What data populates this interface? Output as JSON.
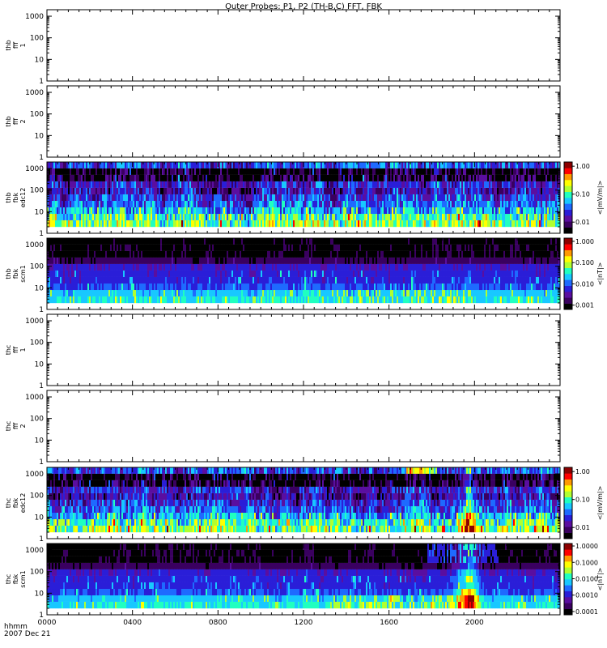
{
  "chart_data": {
    "type": "heatmap",
    "title": "Outer Probes: P1, P2 (TH-B,C) FFT, FBK",
    "x_axis": {
      "title_lines": [
        "hhmm",
        "2007 Dec 21"
      ],
      "range": [
        0,
        1440
      ],
      "tick_labels": [
        "0000",
        "0400",
        "0800",
        "1200",
        "1600",
        "2000"
      ],
      "tick_minutes": [
        0,
        240,
        480,
        720,
        960,
        1200
      ],
      "minor_step_minutes": 30
    },
    "y_axis": {
      "scale": "log",
      "range": [
        1,
        2000
      ],
      "tick_labels": [
        "1",
        "10",
        "100",
        "1000"
      ],
      "tick_values": [
        1,
        10,
        100,
        1000
      ],
      "spectrogram_floor": 2
    },
    "panels": [
      {
        "ylabel_lines": [
          "thb",
          "fff",
          "1"
        ],
        "kind": "empty"
      },
      {
        "ylabel_lines": [
          "thb",
          "fff",
          "2"
        ],
        "kind": "empty"
      },
      {
        "ylabel_lines": [
          "thb",
          "fbk",
          "edc12"
        ],
        "kind": "edc",
        "seed": 11,
        "colorbar": {
          "label": "<|mV/m|>",
          "tick_labels": [
            "1.00",
            "0.10",
            "0.01"
          ],
          "log_range": [
            -2.4,
            0.15
          ]
        }
      },
      {
        "ylabel_lines": [
          "thb",
          "fbk",
          "scm1"
        ],
        "kind": "scm",
        "seed": 23,
        "colorbar": {
          "label": "<|nT|>",
          "tick_labels": [
            "1.000",
            "0.100",
            "0.010",
            "0.001"
          ],
          "log_range": [
            -3.2,
            0.15
          ]
        }
      },
      {
        "ylabel_lines": [
          "thc",
          "fff",
          "1"
        ],
        "kind": "empty"
      },
      {
        "ylabel_lines": [
          "thc",
          "fff",
          "2"
        ],
        "kind": "empty"
      },
      {
        "ylabel_lines": [
          "thc",
          "fbk",
          "edc12"
        ],
        "kind": "edc",
        "seed": 37,
        "event": true,
        "colorbar": {
          "label": "<|mV/m|>",
          "tick_labels": [
            "1.00",
            "0.10",
            "0.01"
          ],
          "log_range": [
            -2.4,
            0.15
          ]
        }
      },
      {
        "ylabel_lines": [
          "thc",
          "fbk",
          "scm1"
        ],
        "kind": "scm",
        "seed": 53,
        "event": true,
        "colorbar": {
          "label": "<|nT|>",
          "tick_labels": [
            "1.0000",
            "0.1000",
            "0.0100",
            "0.0010",
            "0.0001"
          ],
          "log_range": [
            -4.2,
            0.15
          ]
        }
      }
    ],
    "frequency_bands": [
      2.9,
      5.7,
      11.4,
      22.8,
      45.6,
      91.2,
      182.4,
      364.8,
      729.6,
      1459.2
    ],
    "colormap": [
      "#000000",
      "#3a0060",
      "#5a0ea0",
      "#2a1ed8",
      "#1e6aff",
      "#18c8ff",
      "#20ffc0",
      "#b0ff30",
      "#ffff00",
      "#ff9a00",
      "#ff0000",
      "#8c0000"
    ],
    "legend": "right",
    "grid": false
  }
}
